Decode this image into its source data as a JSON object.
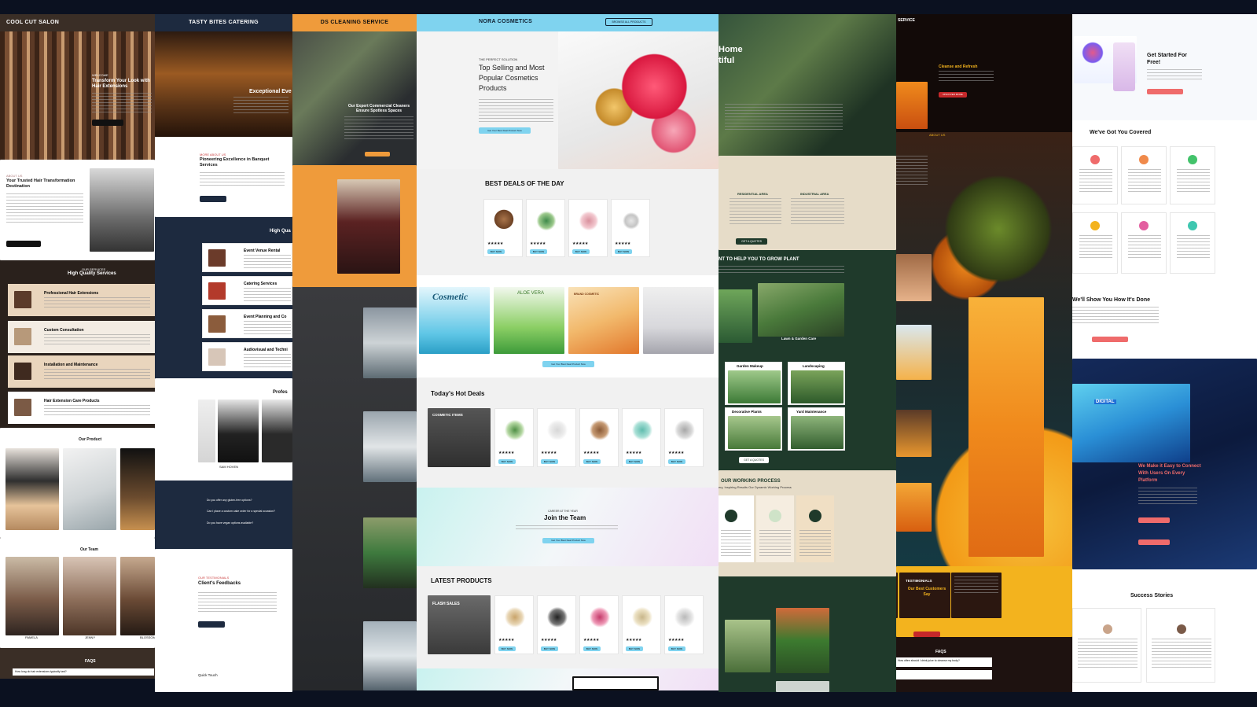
{
  "colors": {
    "bg": "#0b1120",
    "salon": "#2a211c",
    "tasty": "#1d2a3f",
    "clean_orange": "#ef9b3b",
    "cosmetic_blue": "#7fd3ef",
    "garden": "#1f3a2b",
    "juice": "#2b1710",
    "juice_yellow": "#f3b31e",
    "saas_pink": "#ef6b6b"
  },
  "salon": {
    "title": "COOL CUT SALON",
    "welcome": "WELCOME",
    "hero_title": "Transform Your Look with Hair Extensions",
    "about_small": "ABOUT US",
    "about_title": "Your Trusted Hair Transformation Destination",
    "services_small": "OUR SERVICES",
    "services_title": "High Quality Services",
    "services": [
      {
        "title": "Professional Hair Extensions"
      },
      {
        "title": "Custom Consultation"
      },
      {
        "title": "Installation and Maintenance"
      },
      {
        "title": "Hair Extension Care Products"
      }
    ],
    "product_title": "Our Product",
    "team_title": "Our Team",
    "team": [
      "PAMELA",
      "JENNY",
      "BLOSSOM"
    ],
    "faqs": "FAQS",
    "faq_q": "How long do hair extensions typically last?"
  },
  "tasty": {
    "title": "TASTY BITES CATERING",
    "hero": "Exceptional Eve",
    "about_small": "MORE ABOUT US",
    "about_title": "Pioneering Excellence in Banquet Services",
    "section": "High Qua",
    "services": [
      {
        "title": "Event Venue Rental"
      },
      {
        "title": "Catering Services"
      },
      {
        "title": "Event Planning and Co"
      },
      {
        "title": "Audiovisual and Techni"
      }
    ],
    "prof": "Profes",
    "person": "SAM HOVEN",
    "faqs": [
      "Do you offer any gluten-free options?",
      "Can I place a custom cake order for a special occasion?",
      "Do you have vegan options available?"
    ],
    "testimonials_small": "OUR TESTIMONIALS",
    "testimonials_title": "Client's Feedbacks",
    "quick": "Quick Touch"
  },
  "clean": {
    "title": "DS CLEANING SERVICE",
    "hero": "Our Expert Commercial Cleaners Ensure Spotless Spaces"
  },
  "cosmetics": {
    "title": "NORA COSMETICS",
    "nav_btn": "BROWSE ALL PRODUCTS",
    "kicker": "THE PERFECT SOLUTION",
    "hero_title": "Top Selling and Most Popular Cosmetics Products",
    "hero_btn": "Get Your Best Deal Product Now",
    "best_deals": "BEST DEALS OF THE DAY",
    "buy": "BUY NOW",
    "stars": "★★★★★",
    "banners": [
      "Cosmetic",
      "ALOE VERA",
      "BRAND COSMETIC",
      ""
    ],
    "banner_btn": "Get Your Best Deal Product Now",
    "hot_deals": "Today's Hot Deals",
    "cosmetic_items": "COSMETIC ITEMS",
    "join_small": "CAREER AT THE YEAR",
    "join_title": "Join the Team",
    "latest": "LATEST PRODUCTS",
    "flash": "FLASH SALES"
  },
  "garden": {
    "hero": "Home\ntiful",
    "res": "RESIDENTIAL AREA",
    "ind": "INDUSTRIAL AREA",
    "quote_btn": "GET A QUOTES",
    "grow_title": "NT TO HELP YOU TO GROW PLANT",
    "lawn": "Lawn & Garden Care",
    "services": [
      "Garden Makeup",
      "Landscaping",
      "Decorative Plants",
      "Yard Maintenance"
    ],
    "quote_btn2": "GET A QUOTES",
    "process_title": "OUR WORKING PROCESS",
    "process_sub": "ery, Inspiring Results Our Dynamic Working Process"
  },
  "juice": {
    "title": "SERVICE",
    "hero": "Cleanse and Refresh",
    "btn": "DISCOVER MORE",
    "about": "ABOUT US",
    "testimonial_small": "TESTIMONIALS",
    "testimonial_title": "Our Best Customers Say",
    "faqs": "FAQS",
    "faq_q": "How often should I drink juice to cleanse my body?"
  },
  "saas": {
    "get_started": "Get Started For Free!",
    "covered": "We've Got You Covered",
    "show": "We'll Show You How It's Done",
    "digital": "DIGITAL",
    "connect": "We Make it Easy to Connect With Users On Every Platform",
    "success": "Success Stories"
  }
}
